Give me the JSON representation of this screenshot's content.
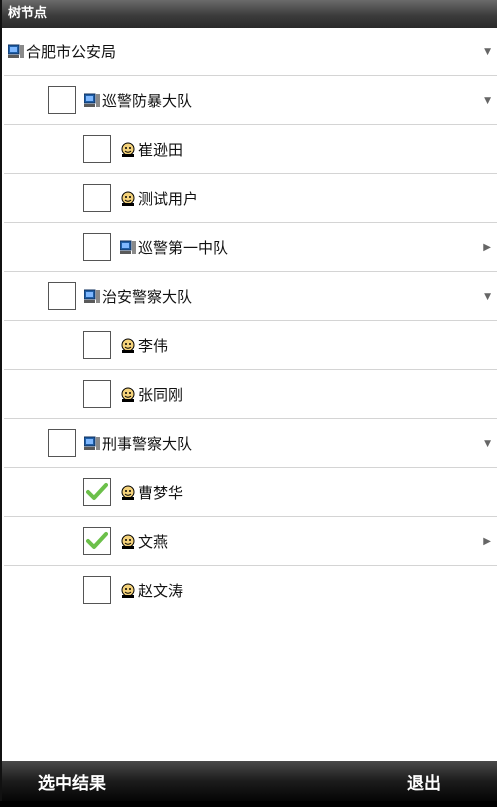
{
  "title": "树节点",
  "tree": {
    "root_label": "合肥市公安局",
    "group1_label": "巡警防暴大队",
    "g1_item1_label": "崔逊田",
    "g1_item2_label": "测试用户",
    "g1_item3_label": "巡警第一中队",
    "group2_label": "治安警察大队",
    "g2_item1_label": "李伟",
    "g2_item2_label": "张同刚",
    "group3_label": "刑事警察大队",
    "g3_item1_label": "曹梦华",
    "g3_item2_label": "文燕",
    "g3_item3_label": "赵文涛",
    "checked": [
      "曹梦华",
      "文燕"
    ]
  },
  "bottom": {
    "select_result_label": "选中结果",
    "exit_label": "退出"
  },
  "icons": {
    "department": "computer-icon",
    "person": "person-icon",
    "expanded": "triangle-down-icon",
    "collapsed": "triangle-right-icon",
    "check": "check-icon"
  },
  "colors": {
    "check": "#6cc04a",
    "department_icon": "#1f5fa8"
  }
}
